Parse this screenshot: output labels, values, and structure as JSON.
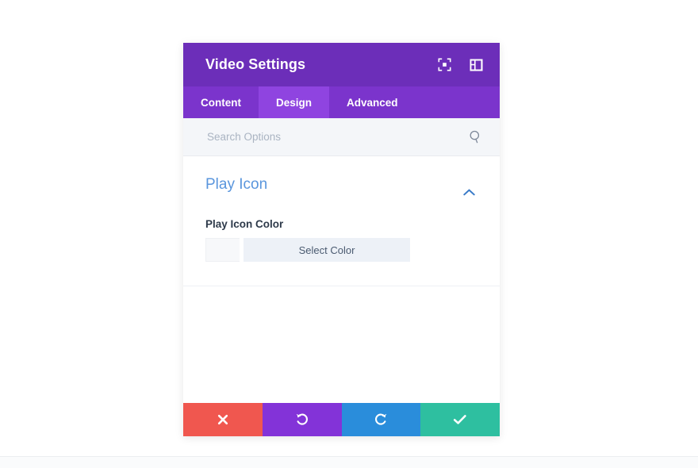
{
  "modal": {
    "title": "Video Settings",
    "header_actions": [
      {
        "name": "focus-icon",
        "label": "Focus"
      },
      {
        "name": "layout-panel-icon",
        "label": "Layout"
      }
    ],
    "tabs": [
      {
        "label": "Content",
        "active": false
      },
      {
        "label": "Design",
        "active": true
      },
      {
        "label": "Advanced",
        "active": false
      }
    ],
    "search": {
      "placeholder": "Search Options",
      "value": "",
      "icon": "search-icon"
    },
    "groups": [
      {
        "title": "Play Icon",
        "collapsed": false,
        "toggle_icon": "chevron-up-icon",
        "fields": [
          {
            "label": "Play Icon Color",
            "type": "color",
            "swatch_color": "#f7f8fa",
            "button_label": "Select Color"
          }
        ]
      }
    ],
    "actions": [
      {
        "name": "cancel-button",
        "icon": "close-icon",
        "color": "#f0574f"
      },
      {
        "name": "undo-button",
        "icon": "undo-icon",
        "color": "#8333d8"
      },
      {
        "name": "redo-button",
        "icon": "redo-icon",
        "color": "#2a8ddb"
      },
      {
        "name": "save-button",
        "icon": "check-icon",
        "color": "#2ebfa0"
      }
    ]
  },
  "theme": {
    "header_purple": "#6c2eb9",
    "tabbar_purple": "#7b34cc",
    "tab_active_purple": "#8f44e0",
    "group_title_blue": "#5a96dd",
    "search_bg": "#f4f6f9"
  }
}
